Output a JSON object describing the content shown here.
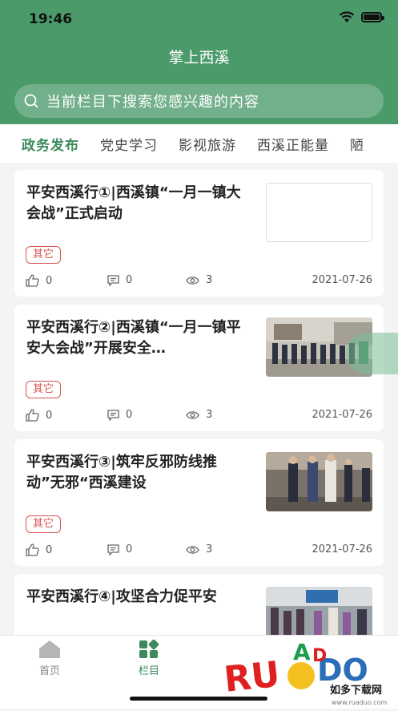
{
  "status_bar": {
    "time": "19:46"
  },
  "header": {
    "title": "掌上西溪"
  },
  "search": {
    "placeholder": "当前栏目下搜索您感兴趣的内容"
  },
  "tabs": [
    {
      "label": "政务发布"
    },
    {
      "label": "党史学习"
    },
    {
      "label": "影视旅游"
    },
    {
      "label": "西溪正能量"
    },
    {
      "label": "陋"
    }
  ],
  "articles": [
    {
      "title": "平安西溪行①|西溪镇“一月一镇大会战”正式启动",
      "tag": "其它",
      "likes": "0",
      "comments": "0",
      "views": "3",
      "date": "2021-07-26"
    },
    {
      "title": "平安西溪行②|西溪镇“一月一镇平安大会战”开展安全…",
      "tag": "其它",
      "likes": "0",
      "comments": "0",
      "views": "3",
      "date": "2021-07-26"
    },
    {
      "title": "平安西溪行③|筑牢反邪防线推动”无邪“西溪建设",
      "tag": "其它",
      "likes": "0",
      "comments": "0",
      "views": "3",
      "date": "2021-07-26"
    },
    {
      "title": "平安西溪行④|攻坚合力促平安",
      "tag": "",
      "likes": "",
      "comments": "",
      "views": "",
      "date": ""
    }
  ],
  "bottom_nav": [
    {
      "label": "首页"
    },
    {
      "label": "栏目"
    }
  ],
  "watermark": {
    "brand": "RUADADO",
    "sub": "如多下载网",
    "url": "www.ruaduo.com"
  },
  "colors": {
    "primary": "#4a9a6a",
    "tag": "#d9534f"
  }
}
